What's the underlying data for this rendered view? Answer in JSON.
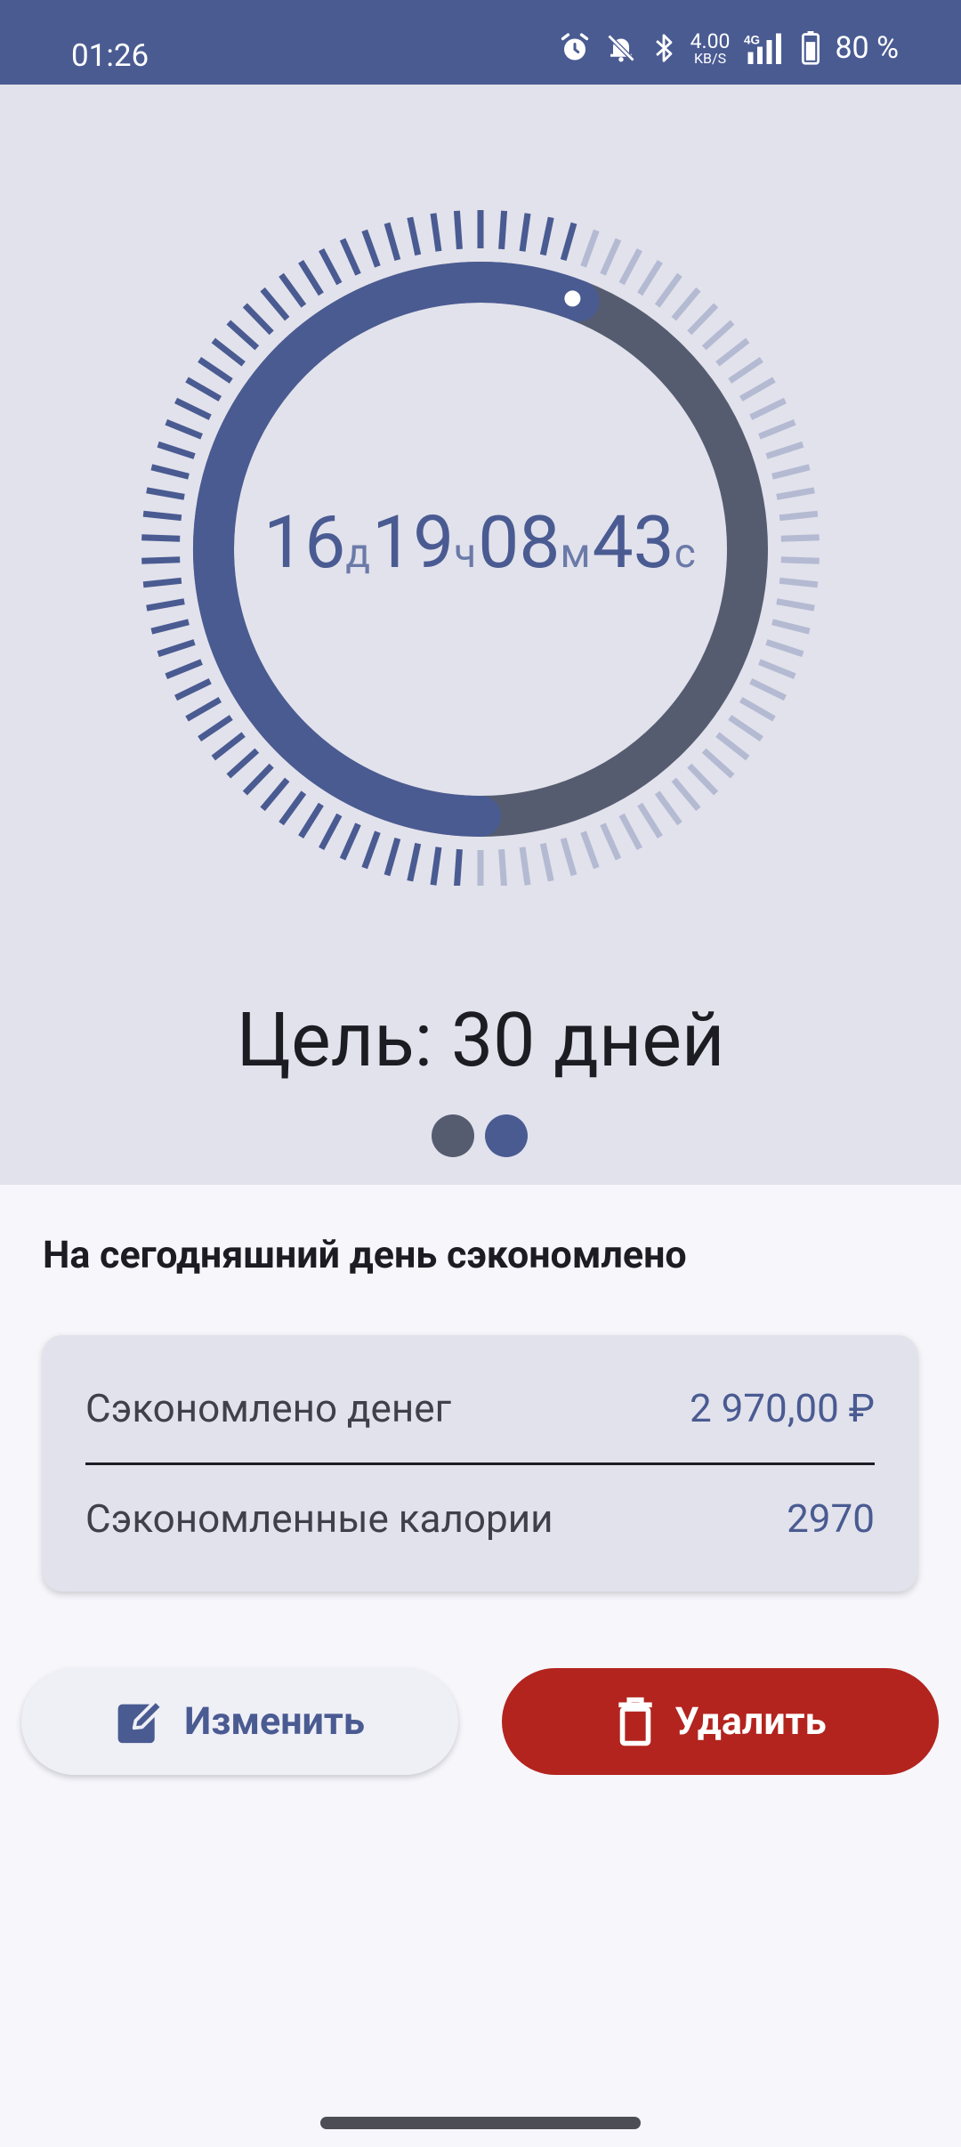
{
  "status_bar": {
    "time": "01:26",
    "net_speed_value": "4.00",
    "net_speed_unit": "KB/S",
    "network_type": "4G",
    "battery_percent": "80 %",
    "icons": [
      "alarm-icon",
      "bell-off-icon",
      "bluetooth-icon",
      "signal-icon",
      "battery-icon"
    ]
  },
  "timer": {
    "days": "16",
    "days_unit": "д",
    "hours": "19",
    "hours_unit": "ч",
    "minutes": "08",
    "minutes_unit": "м",
    "seconds": "43",
    "seconds_unit": "с",
    "progress_fraction": 0.56
  },
  "goal_text": "Цель: 30 дней",
  "pager": {
    "pages": 2,
    "current": 2
  },
  "savings": {
    "title": "На сегодняшний день сэкономлено",
    "money_label": "Сэкономлено денег",
    "money_value": "2 970,00 ₽",
    "calories_label": "Сэкономленные калории",
    "calories_value": "2970"
  },
  "actions": {
    "edit_label": "Изменить",
    "delete_label": "Удалить"
  },
  "colors": {
    "accent": "#4a5b92",
    "ring_track": "#565c70",
    "ticks_inactive": "#b4bad2",
    "hero_bg": "#e2e2ec",
    "delete": "#b3241e"
  }
}
